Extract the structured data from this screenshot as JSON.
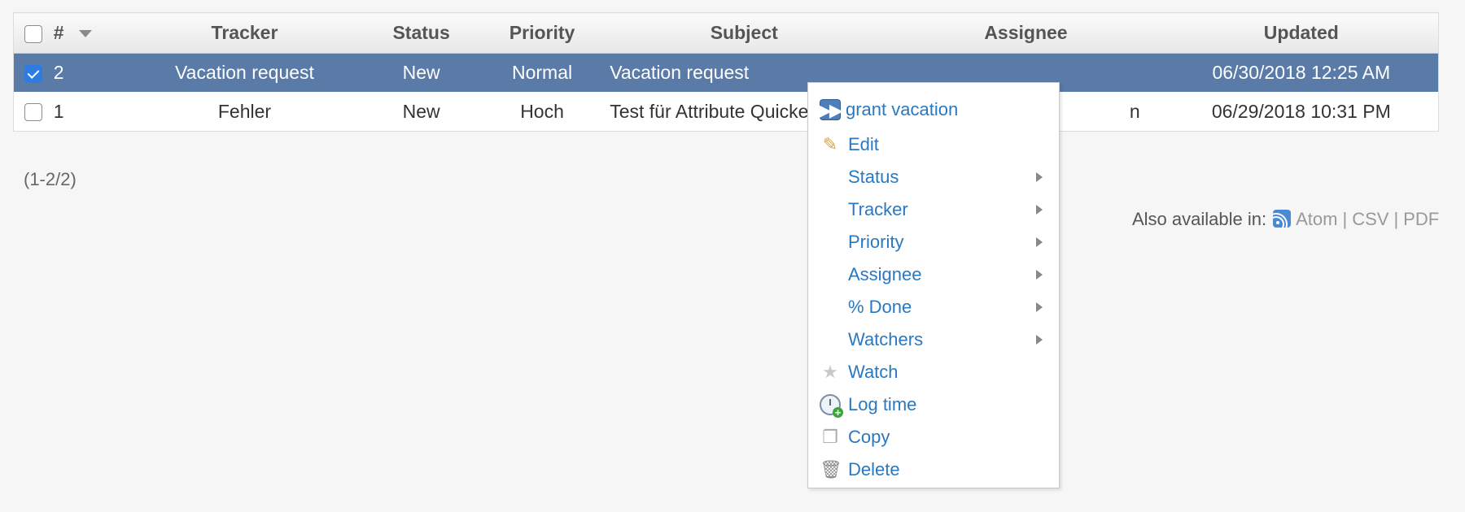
{
  "table": {
    "columns": {
      "id": "#",
      "tracker": "Tracker",
      "status": "Status",
      "priority": "Priority",
      "subject": "Subject",
      "assignee": "Assignee",
      "updated": "Updated"
    },
    "rows": [
      {
        "selected": true,
        "id": "2",
        "tracker": "Vacation request",
        "status": "New",
        "priority": "Normal",
        "subject": "Vacation request",
        "assignee": "",
        "updated": "06/30/2018 12:25 AM"
      },
      {
        "selected": false,
        "id": "1",
        "tracker": "Fehler",
        "status": "New",
        "priority": "Hoch",
        "subject": "Test für Attribute Quickes",
        "assignee": "n",
        "updated": "06/29/2018 10:31 PM"
      }
    ]
  },
  "pagination": "(1-2/2)",
  "other_formats": {
    "label": "Also available in:",
    "atom": "Atom",
    "csv": "CSV",
    "pdf": "PDF",
    "separator": "|"
  },
  "context_menu": {
    "items": [
      {
        "label": "grant vacation",
        "icon": "fast-forward-icon"
      },
      {
        "label": "Edit",
        "icon": "pencil-icon"
      },
      {
        "label": "Status",
        "submenu": true
      },
      {
        "label": "Tracker",
        "submenu": true
      },
      {
        "label": "Priority",
        "submenu": true
      },
      {
        "label": "Assignee",
        "submenu": true
      },
      {
        "label": "% Done",
        "submenu": true
      },
      {
        "label": "Watchers",
        "submenu": true
      },
      {
        "label": "Watch",
        "icon": "star-icon"
      },
      {
        "label": "Log time",
        "icon": "clock-add-icon"
      },
      {
        "label": "Copy",
        "icon": "copy-icon"
      },
      {
        "label": "Delete",
        "icon": "trash-icon"
      }
    ]
  },
  "colors": {
    "selected_row": "#5a7aa8",
    "link": "#2a78c0",
    "background": "#f6f6f6"
  }
}
